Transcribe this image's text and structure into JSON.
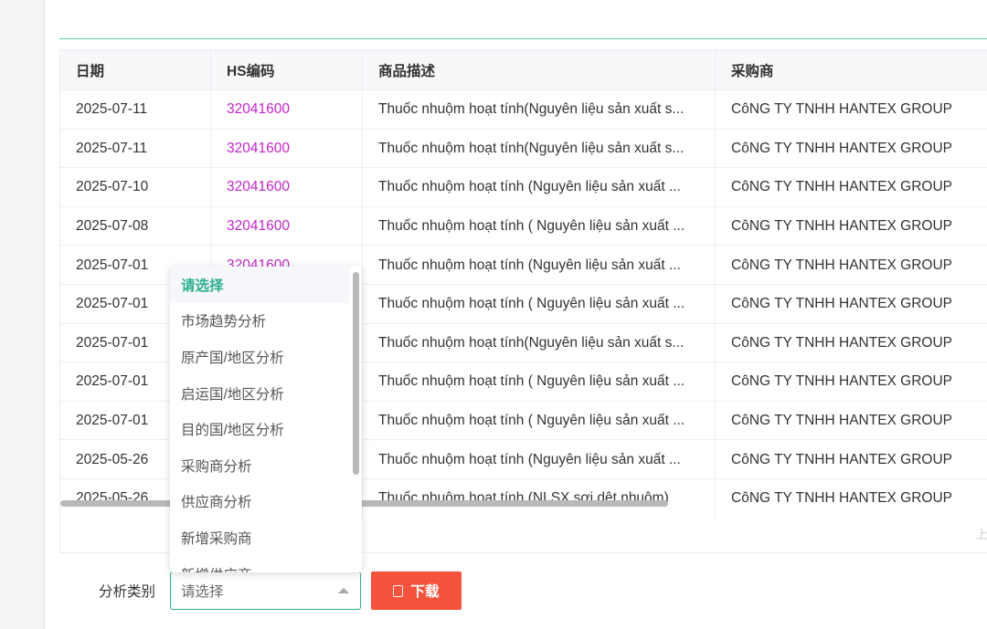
{
  "table": {
    "headers": [
      "日期",
      "HS编码",
      "商品描述",
      "采购商"
    ],
    "rows": [
      [
        "2025-07-11",
        "32041600",
        "Thuốc nhuộm hoạt tính(Nguyên liệu sản xuất s...",
        "CôNG TY TNHH HANTEX GROUP"
      ],
      [
        "2025-07-11",
        "32041600",
        "Thuốc nhuộm hoạt tính(Nguyên liệu sản xuất s...",
        "CôNG TY TNHH HANTEX GROUP"
      ],
      [
        "2025-07-10",
        "32041600",
        "Thuốc nhuộm hoạt tính (Nguyên liệu sản xuất ...",
        "CôNG TY TNHH HANTEX GROUP"
      ],
      [
        "2025-07-08",
        "32041600",
        "Thuốc nhuộm hoạt tính ( Nguyên liệu sản xuất ...",
        "CôNG TY TNHH HANTEX GROUP"
      ],
      [
        "2025-07-01",
        "32041600",
        "Thuốc nhuộm hoạt tính (Nguyên liệu sản xuất ...",
        "CôNG TY TNHH HANTEX GROUP"
      ],
      [
        "2025-07-01",
        "",
        "Thuốc nhuộm hoạt tính ( Nguyên liệu sản xuất ...",
        "CôNG TY TNHH HANTEX GROUP"
      ],
      [
        "2025-07-01",
        "",
        "Thuốc nhuộm hoạt tính(Nguyên liệu sản xuất s...",
        "CôNG TY TNHH HANTEX GROUP"
      ],
      [
        "2025-07-01",
        "",
        "Thuốc nhuộm hoạt tính ( Nguyên liệu sản xuất ...",
        "CôNG TY TNHH HANTEX GROUP"
      ],
      [
        "2025-07-01",
        "",
        "Thuốc nhuộm hoạt tính ( Nguyên liệu sản xuất ...",
        "CôNG TY TNHH HANTEX GROUP"
      ],
      [
        "2025-05-26",
        "",
        "Thuốc nhuộm hoạt tính (Nguyên liệu sản xuất ...",
        "CôNG TY TNHH HANTEX GROUP"
      ],
      [
        "2025-05-26",
        "",
        "Thuốc nhuộm hoạt tính (NLSX sợi dệt nhuộm)",
        "CôNG TY TNHH HANTEX GROUP"
      ]
    ],
    "pager_hint": "上"
  },
  "dropdown": {
    "options": [
      "请选择",
      "市场趋势分析",
      "原产国/地区分析",
      "启运国/地区分析",
      "目的国/地区分析",
      "采购商分析",
      "供应商分析",
      "新增采购商",
      "新增供应商"
    ]
  },
  "form": {
    "label": "分析类别",
    "select_placeholder": "请选择",
    "download_label": "下载"
  },
  "colors": {
    "accent": "#2eb08e",
    "hs_code": "#c026c8",
    "download": "#f5533d"
  }
}
